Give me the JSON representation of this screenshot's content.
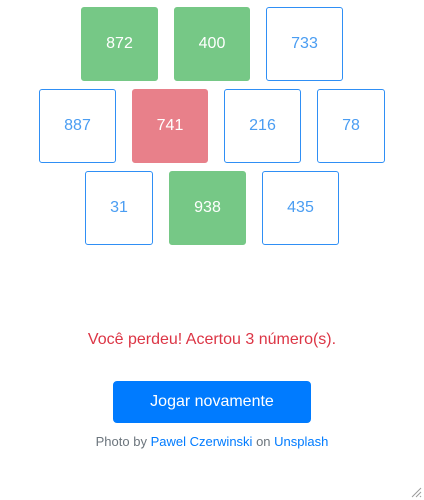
{
  "grid": {
    "row1": [
      {
        "number": "872",
        "state": "hit"
      },
      {
        "number": "400",
        "state": "hit"
      },
      {
        "number": "733",
        "state": "plain"
      }
    ],
    "row2": [
      {
        "number": "887",
        "state": "plain"
      },
      {
        "number": "741",
        "state": "miss"
      },
      {
        "number": "216",
        "state": "plain"
      },
      {
        "number": "78",
        "state": "plain"
      }
    ],
    "row3": [
      {
        "number": "31",
        "state": "plain"
      },
      {
        "number": "938",
        "state": "hit"
      },
      {
        "number": "435",
        "state": "plain"
      }
    ]
  },
  "result": {
    "message": "Você perdeu! Acertou 3 número(s)."
  },
  "actions": {
    "play_again_label": "Jogar novamente"
  },
  "credit": {
    "prefix": "Photo by",
    "author": "Pawel Czerwinski",
    "middle": "on",
    "site": "Unsplash"
  },
  "colors": {
    "hit": "#76c886",
    "miss": "#e8808a",
    "plain_border": "#2f8ff5",
    "plain_text": "#4a9df2",
    "result_text": "#dc3545",
    "button": "#007bff"
  }
}
